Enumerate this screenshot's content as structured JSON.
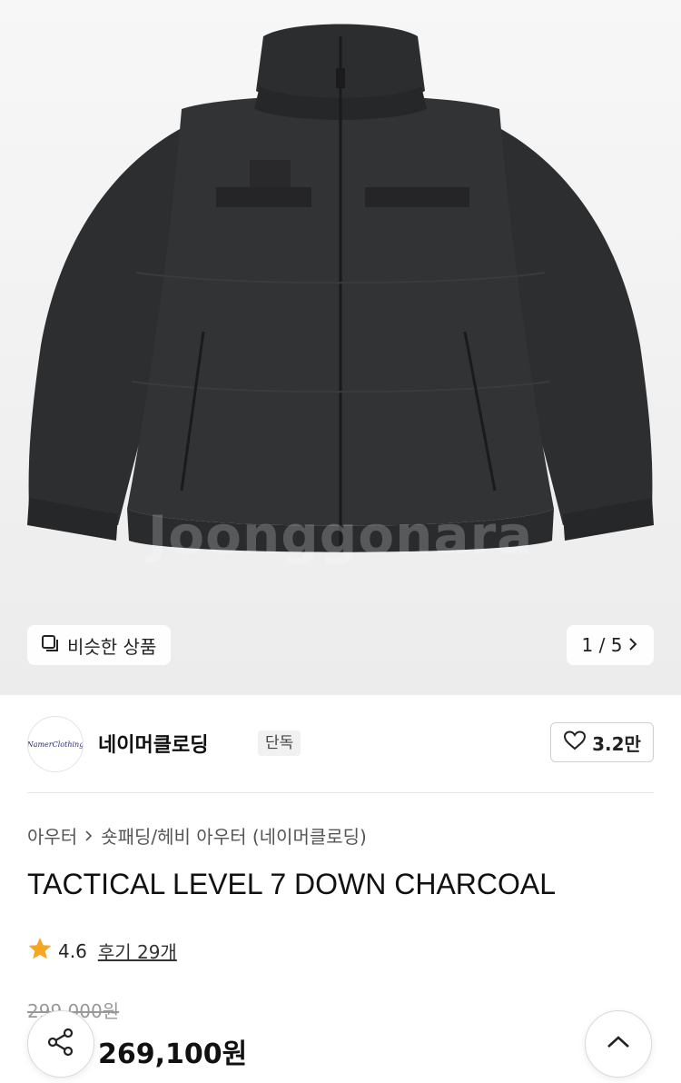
{
  "hero": {
    "watermark": "Joonggonara",
    "similar_label": "비슷한 상품",
    "pager": "1 / 5"
  },
  "shop": {
    "logo_text": "NamerClothing",
    "name": "네이머클로딩",
    "tag": "단독",
    "likes": "3.2만"
  },
  "product": {
    "breadcrumb": [
      "아우터",
      "숏패딩/헤비 아우터 (네이머클로딩)"
    ],
    "title": "TACTICAL LEVEL 7 DOWN CHARCOAL",
    "rating": "4.6",
    "reviews": "후기 29개",
    "original_price": "299,000원",
    "price": "269,100원"
  },
  "colors": {
    "jacket": "#2e2f31",
    "star": "#f5a623"
  }
}
